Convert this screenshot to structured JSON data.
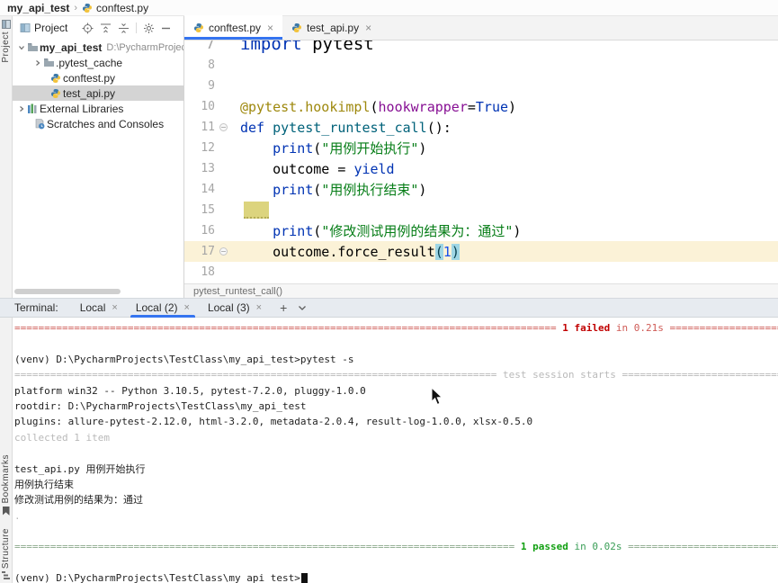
{
  "topbar": {
    "root": "my_api_test",
    "file": "conftest.py"
  },
  "left_strip": {
    "project": "Project",
    "bookmarks": "Bookmarks",
    "structure": "Structure"
  },
  "project": {
    "header": {
      "title": "Project"
    },
    "tree": [
      {
        "label": "my_api_test",
        "extra": "D:\\PycharmProjec",
        "bold": true,
        "selected": false
      },
      {
        "label": ".pytest_cache",
        "selected": false
      },
      {
        "label": "conftest.py",
        "selected": false
      },
      {
        "label": "test_api.py",
        "selected": true
      },
      {
        "label": "External Libraries",
        "selected": false
      },
      {
        "label": "Scratches and Consoles",
        "selected": false
      }
    ]
  },
  "editor": {
    "tabs": [
      {
        "label": "conftest.py",
        "active": true
      },
      {
        "label": "test_api.py",
        "active": false
      }
    ],
    "breadcrumb": "pytest_runtest_call()",
    "lines": [
      {
        "num": "7",
        "zoomed": true,
        "segments": [
          {
            "t": "import",
            "c": "kw"
          },
          {
            "t": " pytest",
            "c": "p"
          }
        ]
      },
      {
        "num": "8",
        "segments": []
      },
      {
        "num": "9",
        "segments": []
      },
      {
        "num": "10",
        "segments": [
          {
            "t": "@pytest.hookimpl",
            "c": "dec"
          },
          {
            "t": "(",
            "c": "p"
          },
          {
            "t": "hookwrapper",
            "c": "prm"
          },
          {
            "t": "=",
            "c": "p"
          },
          {
            "t": "True",
            "c": "kw"
          },
          {
            "t": ")",
            "c": "p"
          }
        ]
      },
      {
        "num": "11",
        "fold": true,
        "segments": [
          {
            "t": "def ",
            "c": "kw"
          },
          {
            "t": "pytest_runtest_call",
            "c": "fn"
          },
          {
            "t": "():",
            "c": "p"
          }
        ]
      },
      {
        "num": "12",
        "segments": [
          {
            "t": "    ",
            "c": "p"
          },
          {
            "t": "print",
            "c": "kw"
          },
          {
            "t": "(",
            "c": "p"
          },
          {
            "t": "\"用例开始执行\"",
            "c": "str"
          },
          {
            "t": ")",
            "c": "p"
          }
        ]
      },
      {
        "num": "13",
        "segments": [
          {
            "t": "    outcome = ",
            "c": "p"
          },
          {
            "t": "yield",
            "c": "kw"
          }
        ]
      },
      {
        "num": "14",
        "segments": [
          {
            "t": "    ",
            "c": "p"
          },
          {
            "t": "print",
            "c": "kw"
          },
          {
            "t": "(",
            "c": "p"
          },
          {
            "t": "\"用例执行结束\"",
            "c": "str"
          },
          {
            "t": ")",
            "c": "p"
          }
        ]
      },
      {
        "num": "15",
        "block": true,
        "segments": []
      },
      {
        "num": "16",
        "segments": [
          {
            "t": "    ",
            "c": "p"
          },
          {
            "t": "print",
            "c": "kw"
          },
          {
            "t": "(",
            "c": "p"
          },
          {
            "t": "\"修改测试用例的结果为：通过\"",
            "c": "str"
          },
          {
            "t": ")",
            "c": "p"
          }
        ]
      },
      {
        "num": "17",
        "current": true,
        "fold": true,
        "segments": [
          {
            "t": "    outcome.force_result",
            "c": "p"
          },
          {
            "t": "(",
            "c": "ph"
          },
          {
            "t": "1",
            "c": "num"
          },
          {
            "t": ")",
            "c": "ph"
          }
        ]
      },
      {
        "num": "18",
        "segments": []
      }
    ]
  },
  "terminal": {
    "label": "Terminal:",
    "tabs": [
      {
        "label": "Local",
        "active": false
      },
      {
        "label": "Local (2)",
        "active": true
      },
      {
        "label": "Local (3)",
        "active": false
      }
    ],
    "lines": [
      [
        {
          "eq": 91,
          "c": "r"
        },
        {
          "t": " ",
          "c": "r"
        },
        {
          "t": "1 failed",
          "c": "rb"
        },
        {
          "t": " in 0.21s ",
          "c": "r"
        },
        {
          "eq": 45,
          "c": "r"
        }
      ],
      [],
      [
        {
          "t": "(venv) D:\\PycharmProjects\\TestClass\\my_api_test>pytest -s",
          "c": "p"
        }
      ],
      [
        {
          "eq": 81,
          "c": "dim"
        },
        {
          "t": " test session starts ",
          "c": "dim"
        },
        {
          "eq": 45,
          "c": "dim"
        }
      ],
      [
        {
          "t": "platform win32 -- Python 3.10.5, pytest-7.2.0, pluggy-1.0.0",
          "c": "p"
        }
      ],
      [
        {
          "t": "rootdir: D:\\PycharmProjects\\TestClass\\my_api_test",
          "c": "p"
        }
      ],
      [
        {
          "t": "plugins: allure-pytest-2.12.0, html-3.2.0, metadata-2.0.4, result-log-1.0.0, xlsx-0.5.0",
          "c": "p"
        }
      ],
      [
        {
          "t": "collected 1 item",
          "c": "dim"
        }
      ],
      [],
      [
        {
          "t": "test_api.py 用例开始执行",
          "c": "p"
        }
      ],
      [
        {
          "t": "用例执行结束",
          "c": "p"
        }
      ],
      [
        {
          "t": "修改测试用例的结果为：通过",
          "c": "p"
        }
      ],
      [
        {
          "t": ".",
          "c": "dim"
        }
      ],
      [],
      [
        {
          "eq": 84,
          "c": "g"
        },
        {
          "t": " ",
          "c": "g"
        },
        {
          "t": "1 passed",
          "c": "gb"
        },
        {
          "t": " in 0.02s ",
          "c": "g2"
        },
        {
          "eq": 45,
          "c": "g"
        }
      ],
      [],
      [
        {
          "t": "(venv) D:\\PycharmProjects\\TestClass\\my_api_test>",
          "c": "p"
        },
        {
          "cursor": true
        }
      ]
    ]
  },
  "colors": {
    "accent": "#3574F0",
    "failed_red": "#C10000",
    "passed_green": "#12A012",
    "keyword_blue": "#0033B3",
    "string_green": "#067D17",
    "decorator_olive": "#9E880D",
    "function_teal": "#00627A",
    "number_blue": "#1750EB",
    "param_purple": "#871094"
  }
}
